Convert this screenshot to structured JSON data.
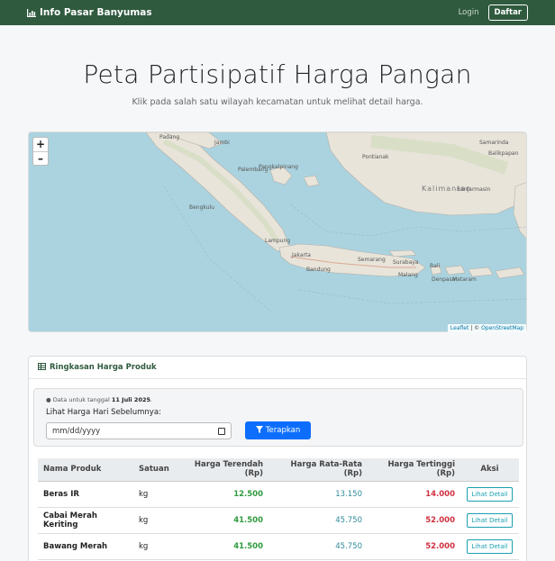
{
  "navbar": {
    "brand": "Info Pasar Banyumas",
    "brand_icon": "bar-chart-icon",
    "login": "Login",
    "register": "Daftar"
  },
  "hero": {
    "title": "Peta Partisipatif Harga Pangan",
    "subtitle": "Klik pada salah satu wilayah kecamatan untuk melihat detail harga."
  },
  "map": {
    "zoom_in": "+",
    "zoom_out": "–",
    "attribution_leaflet": "Leaflet",
    "attribution_sep": " | © ",
    "attribution_osm": "OpenStreetMap",
    "labels": [
      {
        "text": "Padang"
      },
      {
        "text": "Jambi"
      },
      {
        "text": "Palembang"
      },
      {
        "text": "Pangkalpinang"
      },
      {
        "text": "Bengkulu"
      },
      {
        "text": "Lampung"
      },
      {
        "text": "Jakarta"
      },
      {
        "text": "Bandung"
      },
      {
        "text": "Semarang"
      },
      {
        "text": "Surabaya"
      },
      {
        "text": "Malang"
      },
      {
        "text": "Pontianak"
      },
      {
        "text": "Balikpapan"
      },
      {
        "text": "Samarinda"
      },
      {
        "text": "Banjarmasin"
      },
      {
        "text": "Kalimantan"
      },
      {
        "text": "Denpasar"
      },
      {
        "text": "Bali"
      },
      {
        "text": "Mataram"
      }
    ]
  },
  "card": {
    "header": "Ringkasan Harga Produk",
    "header_icon": "table-icon",
    "note_prefix": "Data untuk tanggal ",
    "note_date": "11 Juli 2025",
    "note_suffix": ".",
    "filter_label": "Lihat Harga Hari Sebelumnya:",
    "date_placeholder": "mm/dd/yyyy",
    "apply_label": "Terapkan",
    "columns": [
      "Nama Produk",
      "Satuan",
      "Harga Terendah (Rp)",
      "Harga Rata-Rata (Rp)",
      "Harga Tertinggi (Rp)",
      "Aksi"
    ],
    "rows": [
      {
        "name": "Beras IR",
        "unit": "kg",
        "low": "12.500",
        "avg": "13.150",
        "high": "14.000",
        "action": "Lihat Detail"
      },
      {
        "name": "Cabai Merah Keriting",
        "unit": "kg",
        "low": "41.500",
        "avg": "45.750",
        "high": "52.000",
        "action": "Lihat Detail"
      },
      {
        "name": "Bawang Merah",
        "unit": "kg",
        "low": "41.500",
        "avg": "45.750",
        "high": "52.000",
        "action": "Lihat Detail"
      }
    ]
  }
}
